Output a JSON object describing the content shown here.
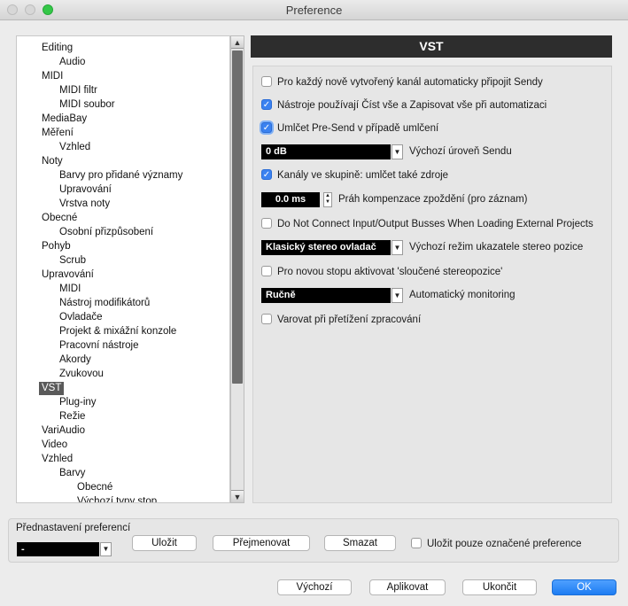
{
  "window": {
    "title": "Preference"
  },
  "tree": {
    "items": [
      {
        "label": "Editing",
        "level": 1
      },
      {
        "label": "Audio",
        "level": 2
      },
      {
        "label": "MIDI",
        "level": 1
      },
      {
        "label": "MIDI filtr",
        "level": 2
      },
      {
        "label": "MIDI soubor",
        "level": 2
      },
      {
        "label": "MediaBay",
        "level": 1
      },
      {
        "label": "Měření",
        "level": 1
      },
      {
        "label": "Vzhled",
        "level": 2
      },
      {
        "label": "Noty",
        "level": 1
      },
      {
        "label": "Barvy pro přidané významy",
        "level": 2
      },
      {
        "label": "Upravování",
        "level": 2
      },
      {
        "label": "Vrstva noty",
        "level": 2
      },
      {
        "label": "Obecné",
        "level": 1
      },
      {
        "label": "Osobní přizpůsobení",
        "level": 2
      },
      {
        "label": "Pohyb",
        "level": 1
      },
      {
        "label": "Scrub",
        "level": 2
      },
      {
        "label": "Upravování",
        "level": 1
      },
      {
        "label": "MIDI",
        "level": 2
      },
      {
        "label": "Nástroj modifikátorů",
        "level": 2
      },
      {
        "label": "Ovladače",
        "level": 2
      },
      {
        "label": "Projekt & mixážní konzole",
        "level": 2
      },
      {
        "label": "Pracovní nástroje",
        "level": 2
      },
      {
        "label": "Akordy",
        "level": 2
      },
      {
        "label": "Zvukovou",
        "level": 2
      },
      {
        "label": "VST",
        "level": 1,
        "selected": true
      },
      {
        "label": "Plug-iny",
        "level": 2
      },
      {
        "label": "Režie",
        "level": 2
      },
      {
        "label": "VariAudio",
        "level": 1
      },
      {
        "label": "Video",
        "level": 1
      },
      {
        "label": "Vzhled",
        "level": 1
      },
      {
        "label": "Barvy",
        "level": 2
      },
      {
        "label": "Obecné",
        "level": 3
      },
      {
        "label": "Výchozí typy stop",
        "level": 3
      }
    ]
  },
  "panel": {
    "title": "VST",
    "options": {
      "auto_connect_sends": {
        "label": "Pro každý nově vytvořený kanál automaticky připojit Sendy",
        "checked": false
      },
      "tools_read_write": {
        "label": "Nástroje používají Číst vše a Zapisovat vše při automatizaci",
        "checked": true
      },
      "mute_presend": {
        "label": "Umlčet Pre-Send v případě umlčení",
        "checked": true
      },
      "send_level": {
        "value": "0 dB",
        "label": "Výchozí úroveň Sendu"
      },
      "group_mute_sources": {
        "label": "Kanály ve skupině: umlčet také zdroje",
        "checked": true
      },
      "delay_threshold": {
        "value": "0.0 ms",
        "label": "Práh kompenzace zpoždění (pro záznam)"
      },
      "no_connect_busses": {
        "label": "Do Not Connect Input/Output Busses When Loading External Projects",
        "checked": false
      },
      "stereo_pan_mode": {
        "value": "Klasický stereo ovladač",
        "label": "Výchozí režim ukazatele stereo pozice"
      },
      "combined_stereo": {
        "label": "Pro novou stopu aktivovat 'sloučené stereopozice'",
        "checked": false
      },
      "auto_monitoring": {
        "value": "Ručně",
        "label": "Automatický monitoring"
      },
      "warn_overload": {
        "label": "Varovat při přetížení zpracování",
        "checked": false
      }
    }
  },
  "presets": {
    "title": "Přednastavení preferencí",
    "selected": "-",
    "save_label": "Uložit",
    "rename_label": "Přejmenovat",
    "delete_label": "Smazat",
    "save_marked_label": "Uložit pouze označené preference",
    "save_marked_checked": false
  },
  "footer": {
    "default_label": "Výchozí",
    "apply_label": "Aplikovat",
    "close_label": "Ukončit",
    "ok_label": "OK"
  },
  "colors": {
    "accent": "#1d7cf2",
    "header": "#2d2d2d",
    "selection": "#5a5a5a"
  }
}
